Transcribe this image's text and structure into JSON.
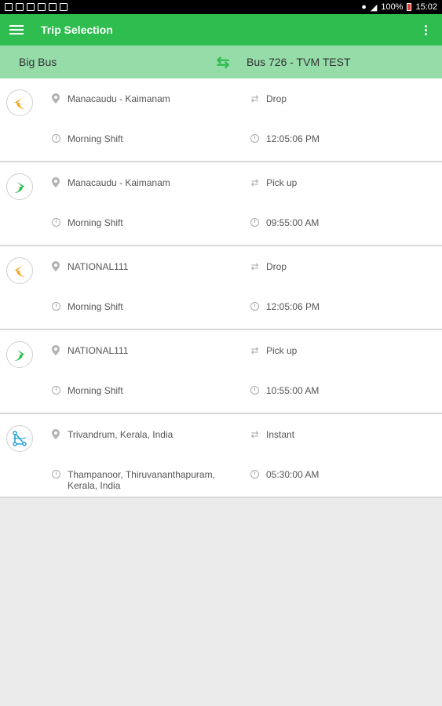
{
  "status_bar": {
    "battery": "100%",
    "time": "15:02"
  },
  "app_bar": {
    "title": "Trip Selection"
  },
  "sub_bar": {
    "left": "Big Bus",
    "right": "Bus 726 - TVM TEST"
  },
  "trips": [
    {
      "type": "drop",
      "route": "Manacaudu - Kaimanam",
      "mode": "Drop",
      "shift": "Morning Shift",
      "time": "12:05:06 PM"
    },
    {
      "type": "pickup",
      "route": "Manacaudu - Kaimanam",
      "mode": "Pick up",
      "shift": "Morning Shift",
      "time": "09:55:00 AM"
    },
    {
      "type": "drop",
      "route": "NATIONAL111",
      "mode": "Drop",
      "shift": "Morning Shift",
      "time": "12:05:06 PM"
    },
    {
      "type": "pickup",
      "route": "NATIONAL111",
      "mode": "Pick up",
      "shift": "Morning Shift",
      "time": "10:55:00 AM"
    },
    {
      "type": "instant",
      "route": "Trivandrum, Kerala, India",
      "mode": "Instant",
      "shift": "Thampanoor, Thiruvananthapuram, Kerala, India",
      "time": "05:30:00 AM"
    }
  ],
  "colors": {
    "appbar": "#2ebd4e",
    "subbar": "#95dca9",
    "drop": "#f5a623",
    "pickup": "#2ebd4e",
    "instant": "#29a3d6"
  },
  "icons": {
    "drop": "drop-arrow-icon",
    "pickup": "pickup-arrow-icon",
    "instant": "instant-route-icon"
  }
}
